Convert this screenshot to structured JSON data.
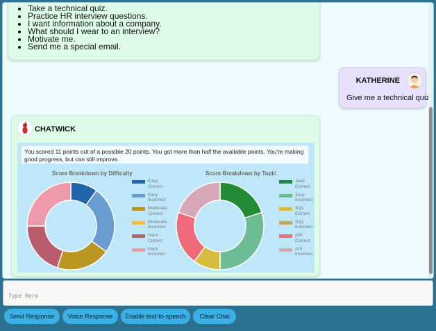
{
  "conversation": {
    "menu_items": [
      "Take a technical quiz.",
      "Practice HR interview questions.",
      "I want information about a company.",
      "What should I wear to an interview?",
      "Motivate me.",
      "Send me a special email."
    ],
    "user_message": {
      "name": "KATHERINE",
      "text": "Give me a technical quiz"
    },
    "bot_message": {
      "name": "CHATWICK",
      "summary": "You scored 11 points out of a possible 20 points. You got more than half the available points. You're making good progress, but can still improve."
    }
  },
  "chart_data": [
    {
      "type": "pie",
      "donut": true,
      "title": "Score Breakdown by Difficulty",
      "categories": [
        "Easy Correct",
        "Easy Incorrect",
        "Moderate Correct",
        "Moderate Incorrect",
        "Hard Correct",
        "Hard Incorrect"
      ],
      "values": [
        2,
        5,
        4,
        0,
        4,
        5
      ],
      "colors": [
        "#2166ab",
        "#6a9ccf",
        "#b8961f",
        "#ecc24d",
        "#b85d6b",
        "#ef9aaa"
      ],
      "legend": "right"
    },
    {
      "type": "pie",
      "donut": true,
      "title": "Score Breakdown by Topic",
      "categories": [
        "Java Correct",
        "Java Incorrect",
        "SQL Correct",
        "SQL Incorrect",
        "API Correct",
        "API Incorrect"
      ],
      "values": [
        4,
        6,
        2,
        0,
        4,
        4
      ],
      "colors": [
        "#238b35",
        "#6cbd93",
        "#d7bc3f",
        "#bfa96a",
        "#ef6a7b",
        "#d7a7b8"
      ],
      "legend": "right"
    }
  ],
  "input": {
    "placeholder": "Type Here"
  },
  "buttons": {
    "send": "Send Response",
    "voice": "Voice Response",
    "tts": "Enable text-to-speech",
    "clear": "Clear Chat"
  },
  "icons": {
    "user_avatar": "person-avatar-icon",
    "bot_avatar": "chatwick-mascot-icon"
  }
}
